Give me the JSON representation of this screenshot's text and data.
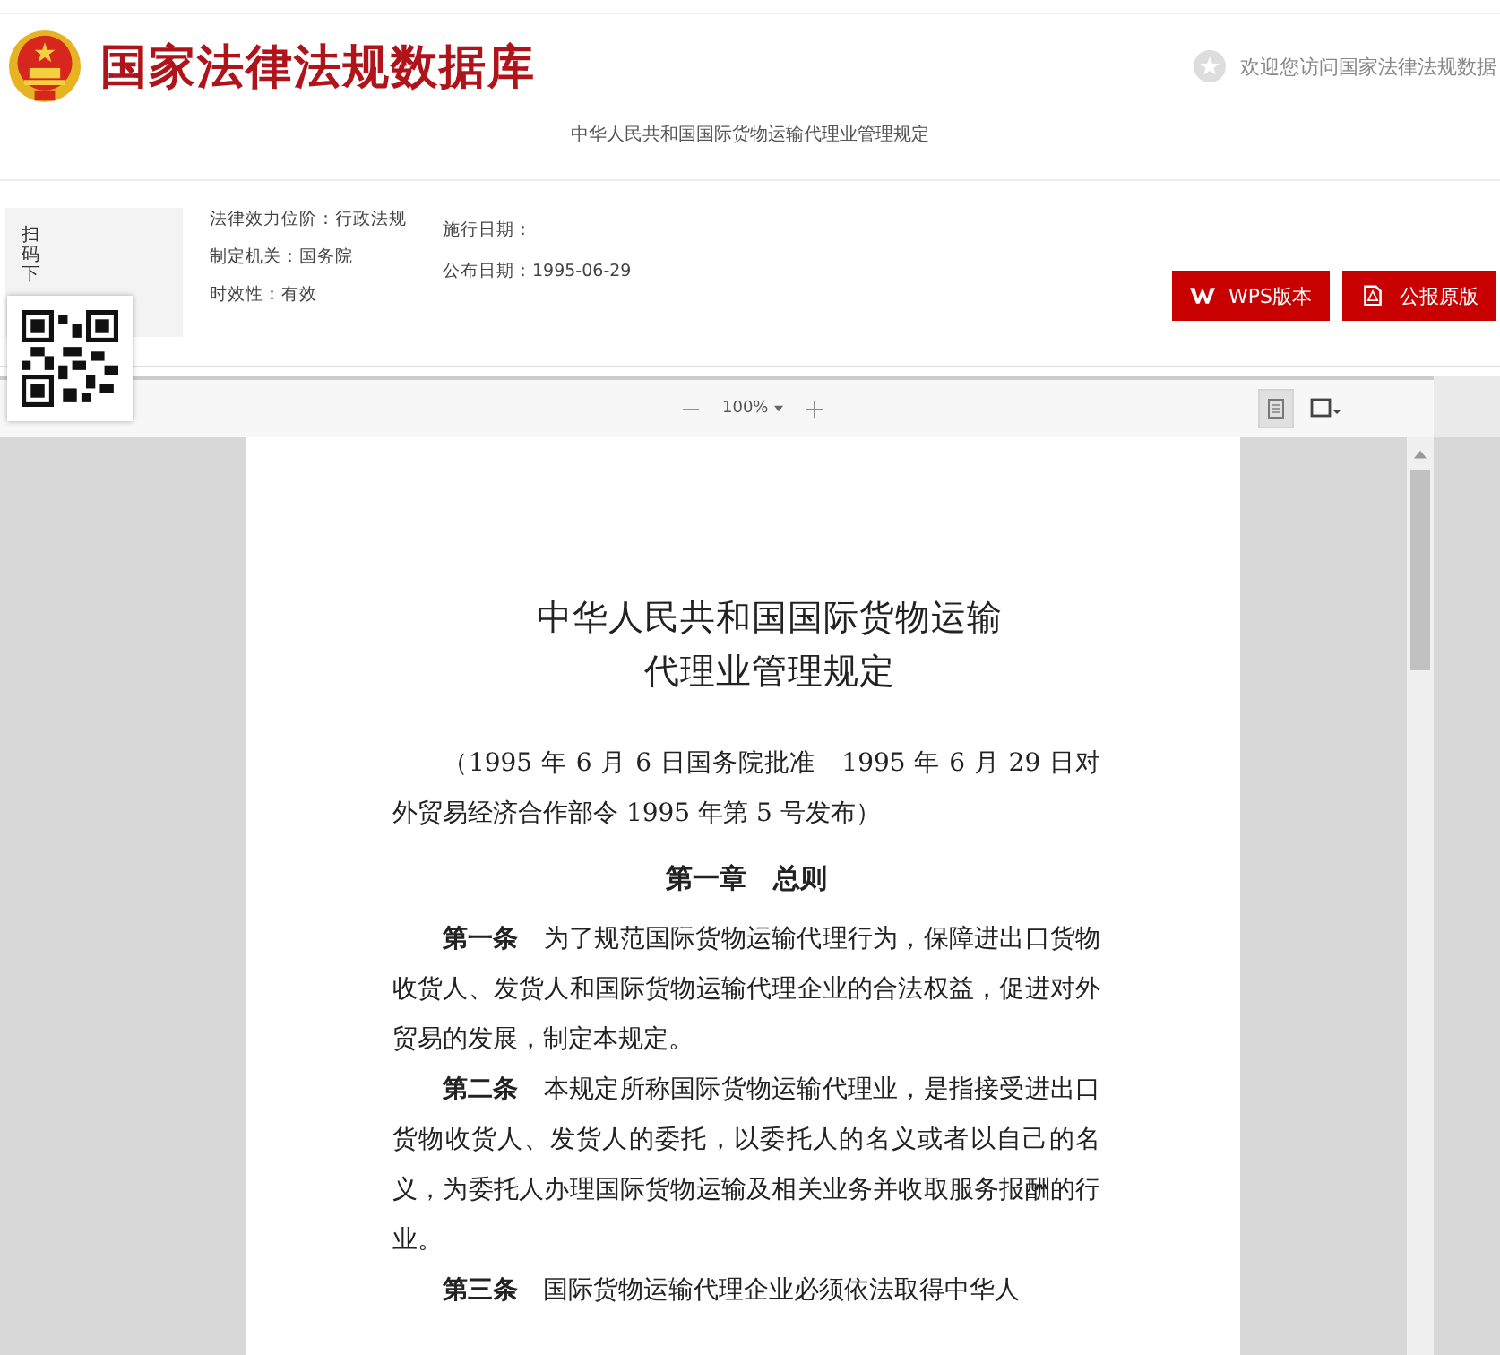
{
  "header": {
    "site_title": "国家法律法规数据库",
    "welcome": "欢迎您访问国家法律法规数据",
    "law_title": "中华人民共和国国际货物运输代理业管理规定"
  },
  "side_panel": {
    "label": "扫码下"
  },
  "info": {
    "left": [
      "法律效力位阶：行政法规",
      "制定机关：国务院",
      "时效性：有效"
    ],
    "right": [
      "施行日期：",
      "公布日期：1995-06-29"
    ]
  },
  "buttons": [
    {
      "kind": "wps",
      "label": "WPS版本"
    },
    {
      "kind": "pdf",
      "label": "公报原版"
    }
  ],
  "viewer": {
    "zoom": "100%",
    "view_modes": [
      {
        "kind": "single",
        "selected": true
      },
      {
        "kind": "double",
        "selected": false
      }
    ]
  },
  "document": {
    "title_lines": [
      "中华人民共和国国际货物运输",
      "代理业管理规定"
    ],
    "blocks": [
      {
        "kind": "note",
        "text": "（1995 年 6 月 6 日国务院批准　1995 年 6 月 29 日对外贸易经济合作部令 1995 年第 5 号发布）"
      },
      {
        "kind": "heading",
        "text": "第一章　总则"
      },
      {
        "kind": "article",
        "text": "**第一条**　为了规范国际货物运输代理行为，保障进出口货物收货人、发货人和国际货物运输代理企业的合法权益，促进对外贸易的发展，制定本规定。"
      },
      {
        "kind": "article",
        "text": "**第二条**　本规定所称国际货物运输代理业，是指接受进出口货物收货人、发货人的委托，以委托人的名义或者以自己的名义，为委托人办理国际货物运输及相关业务并收取服务报酬的行业。"
      },
      {
        "kind": "article",
        "text": "**第三条**　国际货物运输代理企业必须依法取得中华人"
      }
    ]
  }
}
